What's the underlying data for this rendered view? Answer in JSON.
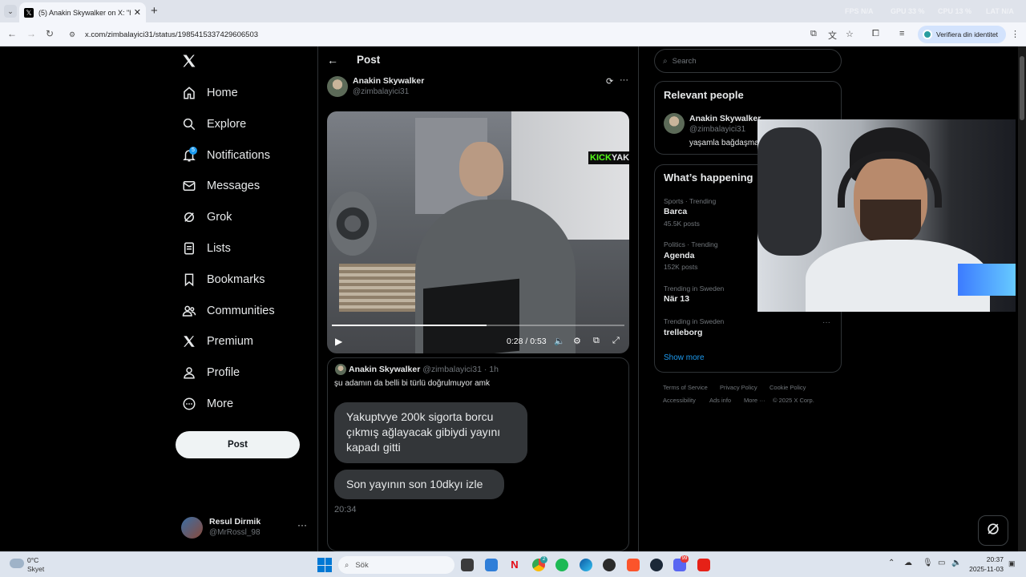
{
  "browser": {
    "tab_title": "(5) Anakin Skywalker on X: \"htt",
    "url": "x.com/zimbalayici31/status/1985415337429606503",
    "verify_label": "Verifiera din identitet",
    "hud": {
      "fps_label": "FPS",
      "fps_value": "N/A",
      "gpu_label": "GPU",
      "gpu_value": "33 %",
      "cpu_label": "CPU",
      "cpu_value": "13 %",
      "lat_label": "LAT",
      "lat_value": "N/A"
    }
  },
  "x_nav": {
    "items": [
      {
        "label": "Home",
        "icon": "home-icon"
      },
      {
        "label": "Explore",
        "icon": "search-icon"
      },
      {
        "label": "Notifications",
        "icon": "bell-icon"
      },
      {
        "label": "Messages",
        "icon": "mail-icon"
      },
      {
        "label": "Grok",
        "icon": "grok-icon"
      },
      {
        "label": "Lists",
        "icon": "list-icon"
      },
      {
        "label": "Bookmarks",
        "icon": "bookmark-icon"
      },
      {
        "label": "Communities",
        "icon": "people-icon"
      },
      {
        "label": "Premium",
        "icon": "x-logo-icon"
      },
      {
        "label": "Profile",
        "icon": "person-icon"
      },
      {
        "label": "More",
        "icon": "more-circle-icon"
      }
    ],
    "notification_count": "5",
    "post_button": "Post",
    "account": {
      "name": "Resul Dirmik",
      "handle": "@MrRossl_98"
    }
  },
  "post": {
    "header_title": "Post",
    "author_name": "Anakin Skywalker",
    "author_handle": "@zimbalayici31",
    "video": {
      "overlay_text_green": "KICK",
      "overlay_text_white": "YAK",
      "time": "0:28 / 0:53",
      "progress": 0.53
    },
    "quote": {
      "author_name": "Anakin Skywalker",
      "author_handle": "@zimbalayici31",
      "time_ago": "· 1h",
      "text": "şu adamın da belli bi türlü doğrulmuyor amk",
      "bubble1": "Yakuptvye 200k sigorta borcu çıkmış ağlayacak gibiydi yayını kapadı gitti",
      "bubble2": "Son yayının son 10dkyı izle",
      "timestamp": "20:34"
    }
  },
  "sidebar": {
    "search_placeholder": "Search",
    "relevant_title": "Relevant people",
    "relevant_person": {
      "name": "Anakin Skywalker",
      "handle": "@zimbalayici31",
      "bio": "yaşamla bağdaşmaz"
    },
    "happening_title": "What’s happening",
    "trends": [
      {
        "category": "Sports · Trending",
        "name": "Barca",
        "count": "45.5K posts"
      },
      {
        "category": "Politics · Trending",
        "name": "Agenda",
        "count": "152K posts"
      },
      {
        "category": "Trending in Sweden",
        "name": "När 13",
        "count": ""
      },
      {
        "category": "Trending in Sweden",
        "name": "trelleborg",
        "count": ""
      }
    ],
    "show_more": "Show more",
    "footer": {
      "terms": "Terms of Service",
      "privacy": "Privacy Policy",
      "cookie": "Cookie Policy",
      "accessibility": "Accessibility",
      "ads": "Ads info",
      "more": "More ···",
      "copyright": "© 2025 X Corp."
    }
  },
  "taskbar": {
    "weather_temp": "0°C",
    "weather_text": "Skyet",
    "search_placeholder": "Sök",
    "time": "20:37",
    "date": "2025-11-03",
    "chrome_badge": "2",
    "discord_badge": "99"
  }
}
